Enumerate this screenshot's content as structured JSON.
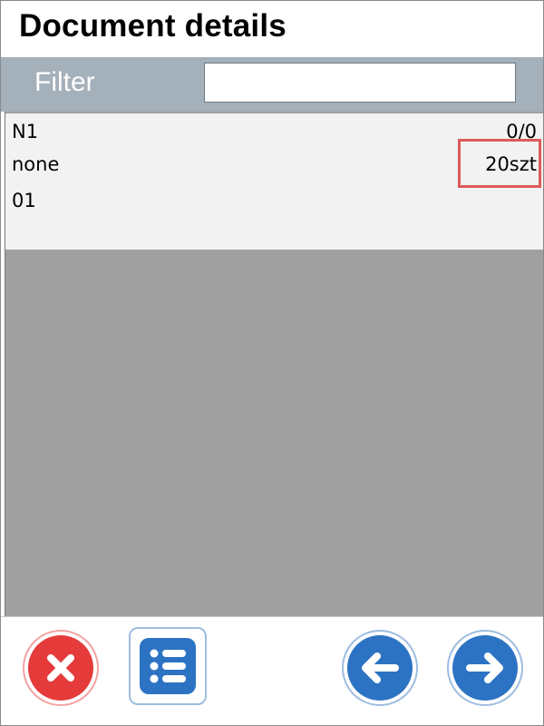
{
  "header": {
    "title": "Document details"
  },
  "filter": {
    "label": "Filter",
    "value": "",
    "placeholder": ""
  },
  "items": [
    {
      "code": "N1",
      "count": "0/0",
      "location": "none",
      "quantity": "20szt",
      "batch": "01"
    }
  ],
  "toolbar": {
    "buttons": [
      {
        "name": "cancel",
        "icon": "close-icon",
        "color": "#e53b3b"
      },
      {
        "name": "list",
        "icon": "list-icon",
        "color": "#2d73c4"
      },
      {
        "name": "previous",
        "icon": "arrow-left-icon",
        "color": "#2d73c4"
      },
      {
        "name": "next",
        "icon": "arrow-right-icon",
        "color": "#2d73c4"
      }
    ]
  },
  "colors": {
    "filter_bar": "#a4b0ba",
    "list_background": "#a0a0a0",
    "item_background": "#f2f2f2",
    "highlight": "#e05a5a"
  }
}
